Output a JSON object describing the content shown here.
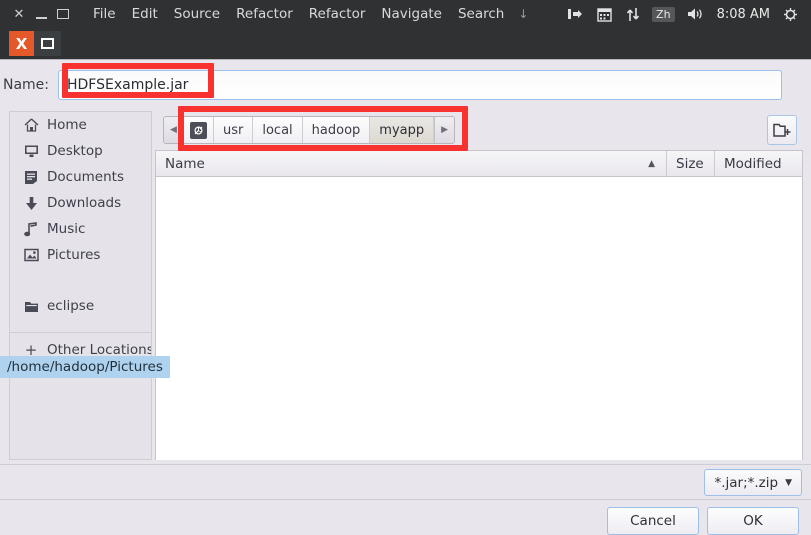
{
  "topbar": {
    "window_controls": [
      {
        "name": "close",
        "glyph": "✕"
      },
      {
        "name": "minimize",
        "glyph": "–"
      },
      {
        "name": "maximize",
        "glyph": "⬜"
      }
    ],
    "menus": [
      "File",
      "Edit",
      "Source",
      "Refactor",
      "Refactor",
      "Navigate",
      "Search"
    ],
    "overflow_glyph": "↓",
    "tray": {
      "vpn_glyph": "❙▶",
      "calendar_glyph": "▦",
      "network_glyph": "↑↓",
      "input_method": "Zh",
      "volume_glyph": "🔊",
      "clock": "8:08 AM",
      "power_glyph": "☀"
    }
  },
  "taskstrip": {
    "close_glyph": "X",
    "restore_name": "restore-window-button"
  },
  "dialog": {
    "name_label": "Name:",
    "name_value": "HDFSExample.jar",
    "name_placeholder": "",
    "sidebar": {
      "items": [
        {
          "label": "Home",
          "icon": "home-icon",
          "glyph": "⌂"
        },
        {
          "label": "Desktop",
          "icon": "desktop-icon",
          "glyph": "▣"
        },
        {
          "label": "Documents",
          "icon": "documents-icon",
          "glyph": "☰"
        },
        {
          "label": "Downloads",
          "icon": "download-icon",
          "glyph": "⬇"
        },
        {
          "label": "Music",
          "icon": "music-icon",
          "glyph": "♪"
        },
        {
          "label": "Pictures",
          "icon": "pictures-icon",
          "glyph": "▧"
        },
        {
          "label": "eclipse",
          "icon": "folder-icon",
          "glyph": "▰"
        }
      ],
      "other_locations": {
        "label": "Other Locations",
        "glyph": "+"
      }
    },
    "tooltip": "/home/hadoop/Pictures",
    "pathbar": {
      "back_glyph": "◀",
      "forward_glyph": "▶",
      "root_glyph": "⚓",
      "crumbs": [
        {
          "label": "usr",
          "selected": false
        },
        {
          "label": "local",
          "selected": false
        },
        {
          "label": "hadoop",
          "selected": false
        },
        {
          "label": "myapp",
          "selected": true
        }
      ]
    },
    "new_folder_tooltip": "Create Folder",
    "columns": [
      {
        "label": "Name",
        "sorted": "asc"
      },
      {
        "label": "Size",
        "sorted": ""
      },
      {
        "label": "Modified",
        "sorted": ""
      }
    ],
    "sort_arrow": "▲",
    "rows": [],
    "filter": {
      "label": "*.jar;*.zip",
      "chevron": "▼"
    },
    "buttons": {
      "cancel": "Cancel",
      "ok": "OK"
    }
  },
  "annotations": {
    "color": "#f7322f",
    "boxes": [
      "name-field-highlight",
      "path-bar-highlight"
    ]
  }
}
